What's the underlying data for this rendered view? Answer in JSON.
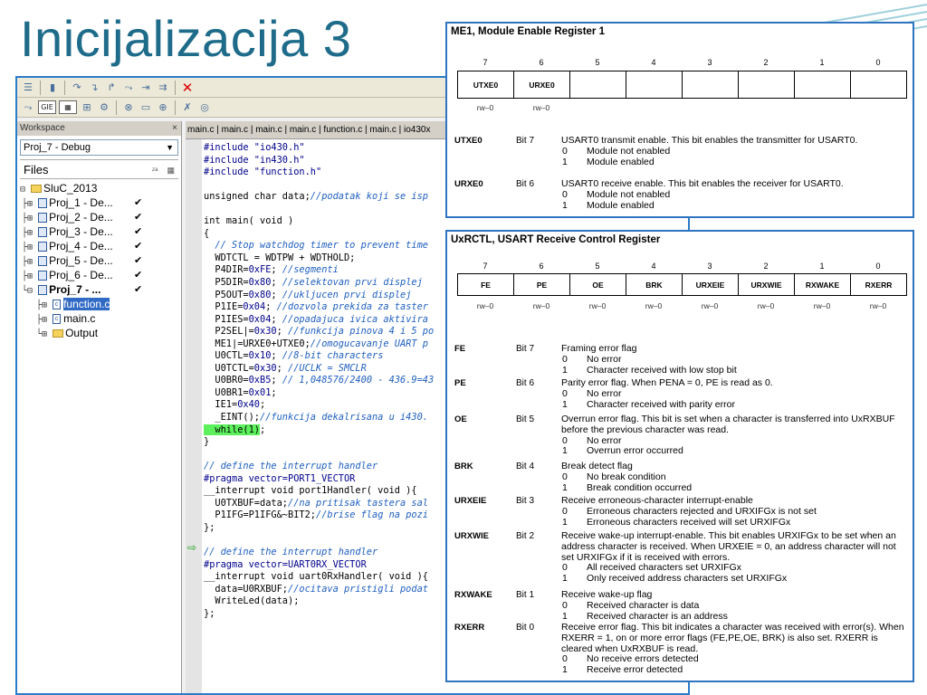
{
  "slide": {
    "title": "Inicijalizacija 3"
  },
  "ide": {
    "workspace": {
      "header": "Workspace",
      "close": "×",
      "config": "Proj_7 - Debug",
      "files_label": "Files",
      "tree": [
        {
          "glyph": "⊟",
          "indent": 0,
          "icon": "folder",
          "label": "SluC_2013"
        },
        {
          "glyph": "├⊞",
          "indent": 1,
          "icon": "proj",
          "label": "Proj_1 - De...",
          "check": "✔"
        },
        {
          "glyph": "├⊞",
          "indent": 1,
          "icon": "proj",
          "label": "Proj_2 - De...",
          "check": "✔"
        },
        {
          "glyph": "├⊞",
          "indent": 1,
          "icon": "proj",
          "label": "Proj_3 - De...",
          "check": "✔"
        },
        {
          "glyph": "├⊞",
          "indent": 1,
          "icon": "proj",
          "label": "Proj_4 - De...",
          "check": "✔"
        },
        {
          "glyph": "├⊞",
          "indent": 1,
          "icon": "proj",
          "label": "Proj_5 - De...",
          "check": "✔"
        },
        {
          "glyph": "├⊞",
          "indent": 1,
          "icon": "proj",
          "label": "Proj_6 - De...",
          "check": "✔"
        },
        {
          "glyph": "└⊟",
          "indent": 1,
          "icon": "proj",
          "label": "Proj_7 - ...",
          "check": "✔",
          "bold": true
        },
        {
          "glyph": "├⊞",
          "indent": 2,
          "icon": "cfile",
          "label": "function.c",
          "selected": true
        },
        {
          "glyph": "├⊞",
          "indent": 2,
          "icon": "cfile",
          "label": "main.c"
        },
        {
          "glyph": "└⊞",
          "indent": 2,
          "icon": "folder",
          "label": "Output"
        }
      ]
    },
    "tabs": "main.c | main.c | main.c | main.c | function.c | main.c | io430x",
    "code": [
      [
        [
          "pp",
          "#include \"io430.h\""
        ]
      ],
      [
        [
          "pp",
          "#include \"in430.h\""
        ]
      ],
      [
        [
          "pp",
          "#include \"function.h\""
        ]
      ],
      [
        [
          "",
          ""
        ]
      ],
      [
        [
          "",
          "unsigned char data;"
        ],
        [
          "cm",
          "//podatak koji se isp"
        ]
      ],
      [
        [
          "",
          ""
        ]
      ],
      [
        [
          "",
          "int main( void )"
        ]
      ],
      [
        [
          "",
          "{"
        ]
      ],
      [
        [
          "cm",
          "  // Stop watchdog timer to prevent time"
        ]
      ],
      [
        [
          "",
          "  WDTCTL = WDTPW + WDTHOLD;"
        ]
      ],
      [
        [
          "",
          "  P4DIR="
        ],
        [
          "pp",
          "0xFE"
        ],
        [
          "",
          "; "
        ],
        [
          "cm",
          "//segmenti"
        ]
      ],
      [
        [
          "",
          "  P5DIR="
        ],
        [
          "pp",
          "0x80"
        ],
        [
          "",
          "; "
        ],
        [
          "cm",
          "//selektovan prvi displej"
        ]
      ],
      [
        [
          "",
          "  P5OUT="
        ],
        [
          "pp",
          "0x80"
        ],
        [
          "",
          "; "
        ],
        [
          "cm",
          "//ukljucen prvi displej"
        ]
      ],
      [
        [
          "",
          "  P1IE="
        ],
        [
          "pp",
          "0x04"
        ],
        [
          "",
          "; "
        ],
        [
          "cm",
          "//dozvola prekida za taster"
        ]
      ],
      [
        [
          "",
          "  P1IES="
        ],
        [
          "pp",
          "0x04"
        ],
        [
          "",
          "; "
        ],
        [
          "cm",
          "//opadajuca ivica aktivira "
        ]
      ],
      [
        [
          "",
          "  P2SEL|="
        ],
        [
          "pp",
          "0x30"
        ],
        [
          "",
          "; "
        ],
        [
          "cm",
          "//funkcija pinova 4 i 5 po"
        ]
      ],
      [
        [
          "",
          "  ME1|=URXE0+UTXE0;"
        ],
        [
          "cm",
          "//omogucavanje UART p"
        ]
      ],
      [
        [
          "",
          "  U0CTL="
        ],
        [
          "pp",
          "0x10"
        ],
        [
          "",
          "; "
        ],
        [
          "cm",
          "//8-bit characters"
        ]
      ],
      [
        [
          "",
          "  U0TCTL="
        ],
        [
          "pp",
          "0x30"
        ],
        [
          "",
          "; "
        ],
        [
          "cm",
          "//UCLK = SMCLR"
        ]
      ],
      [
        [
          "",
          "  U0BR0="
        ],
        [
          "pp",
          "0xB5"
        ],
        [
          "",
          "; "
        ],
        [
          "cm",
          "// 1,048576/2400 - 436.9=43"
        ]
      ],
      [
        [
          "",
          "  U0BR1="
        ],
        [
          "pp",
          "0x01"
        ],
        [
          "",
          ";"
        ]
      ],
      [
        [
          "",
          "  IE1="
        ],
        [
          "pp",
          "0x40"
        ],
        [
          "",
          ";"
        ]
      ],
      [
        [
          "",
          "  _EINT();"
        ],
        [
          "cm",
          "//funkcija dekalrisana u i430."
        ]
      ],
      [
        [
          "hl",
          "  while(1)"
        ],
        [
          "",
          ";"
        ]
      ],
      [
        [
          "",
          "}"
        ]
      ],
      [
        [
          "",
          ""
        ]
      ],
      [
        [
          "cm",
          "// define the interrupt handler"
        ]
      ],
      [
        [
          "pp",
          "#pragma vector=PORT1_VECTOR"
        ]
      ],
      [
        [
          "",
          "__interrupt void port1Handler( void ){"
        ]
      ],
      [
        [
          "",
          "  U0TXBUF=data;"
        ],
        [
          "cm",
          "//na pritisak tastera sal"
        ]
      ],
      [
        [
          "",
          "  P1IFG=P1IFG&~BIT2;"
        ],
        [
          "cm",
          "//brise flag na pozi"
        ]
      ],
      [
        [
          "",
          "};"
        ]
      ],
      [
        [
          "",
          ""
        ]
      ],
      [
        [
          "cm",
          "// define the interrupt handler"
        ]
      ],
      [
        [
          "pp",
          "#pragma vector=UART0RX_VECTOR"
        ]
      ],
      [
        [
          "",
          "__interrupt void uart0RxHandler( void ){"
        ]
      ],
      [
        [
          "",
          "  data=U0RXBUF;"
        ],
        [
          "cm",
          "//ocitava pristigli podat"
        ]
      ],
      [
        [
          "",
          "  WriteLed(data);"
        ]
      ],
      [
        [
          "",
          "};"
        ]
      ]
    ]
  },
  "me1": {
    "title": "ME1, Module Enable Register 1",
    "bits": [
      "7",
      "6",
      "5",
      "4",
      "3",
      "2",
      "1",
      "0"
    ],
    "fields": [
      "UTXE0",
      "URXE0",
      "",
      "",
      "",
      "",
      "",
      ""
    ],
    "rw": [
      "rw–0",
      "rw–0",
      "",
      "",
      "",
      "",
      "",
      ""
    ],
    "descriptions": [
      {
        "name": "UTXE0",
        "bit": "Bit 7",
        "text": "USART0 transmit enable. This bit enables the transmitter for USART0.",
        "options": [
          [
            "0",
            "Module not enabled"
          ],
          [
            "1",
            "Module enabled"
          ]
        ]
      },
      {
        "name": "URXE0",
        "bit": "Bit 6",
        "text": "USART0 receive enable. This bit enables the receiver for USART0.",
        "options": [
          [
            "0",
            "Module not enabled"
          ],
          [
            "1",
            "Module enabled"
          ]
        ]
      }
    ]
  },
  "uxrctl": {
    "title": "UxRCTL, USART Receive Control Register",
    "bits": [
      "7",
      "6",
      "5",
      "4",
      "3",
      "2",
      "1",
      "0"
    ],
    "fields": [
      "FE",
      "PE",
      "OE",
      "BRK",
      "URXEIE",
      "URXWIE",
      "RXWAKE",
      "RXERR"
    ],
    "rw": [
      "rw–0",
      "rw–0",
      "rw–0",
      "rw–0",
      "rw–0",
      "rw–0",
      "rw–0",
      "rw–0"
    ],
    "descriptions": [
      {
        "name": "FE",
        "bit": "Bit 7",
        "text": "Framing error flag",
        "options": [
          [
            "0",
            "No error"
          ],
          [
            "1",
            "Character received with low stop bit"
          ]
        ]
      },
      {
        "name": "PE",
        "bit": "Bit 6",
        "text": "Parity error flag. When PENA = 0, PE is read as 0.",
        "options": [
          [
            "0",
            "No error"
          ],
          [
            "1",
            "Character received with parity error"
          ]
        ]
      },
      {
        "name": "OE",
        "bit": "Bit 5",
        "text": "Overrun error flag. This bit is set when a character is transferred into UxRXBUF before the previous character was read.",
        "options": [
          [
            "0",
            "No error"
          ],
          [
            "1",
            "Overrun error occurred"
          ]
        ]
      },
      {
        "name": "BRK",
        "bit": "Bit 4",
        "text": "Break detect flag",
        "options": [
          [
            "0",
            "No break condition"
          ],
          [
            "1",
            "Break condition occurred"
          ]
        ]
      },
      {
        "name": "URXEIE",
        "bit": "Bit 3",
        "text": "Receive erroneous-character interrupt-enable",
        "options": [
          [
            "0",
            "Erroneous characters rejected and URXIFGx is not set"
          ],
          [
            "1",
            "Erroneous characters received will set URXIFGx"
          ]
        ]
      },
      {
        "name": "URXWIE",
        "bit": "Bit 2",
        "text": "Receive wake-up interrupt-enable. This bit enables URXIFGx to be set when an address character is received. When URXEIE = 0, an address character will not set URXIFGx if it is received with errors.",
        "options": [
          [
            "0",
            "All received characters set URXIFGx"
          ],
          [
            "1",
            "Only received address characters set URXIFGx"
          ]
        ]
      },
      {
        "name": "RXWAKE",
        "bit": "Bit 1",
        "text": "Receive wake-up flag",
        "options": [
          [
            "0",
            "Received character is data"
          ],
          [
            "1",
            "Received character is an address"
          ]
        ]
      },
      {
        "name": "RXERR",
        "bit": "Bit 0",
        "text": "Receive error flag. This bit indicates a character was received with error(s). When RXERR = 1, on or more error flags (FE,PE,OE, BRK) is also set. RXERR is cleared when UxRXBUF is read.",
        "options": [
          [
            "0",
            "No receive errors detected"
          ],
          [
            "1",
            "Receive error detected"
          ]
        ]
      }
    ]
  }
}
